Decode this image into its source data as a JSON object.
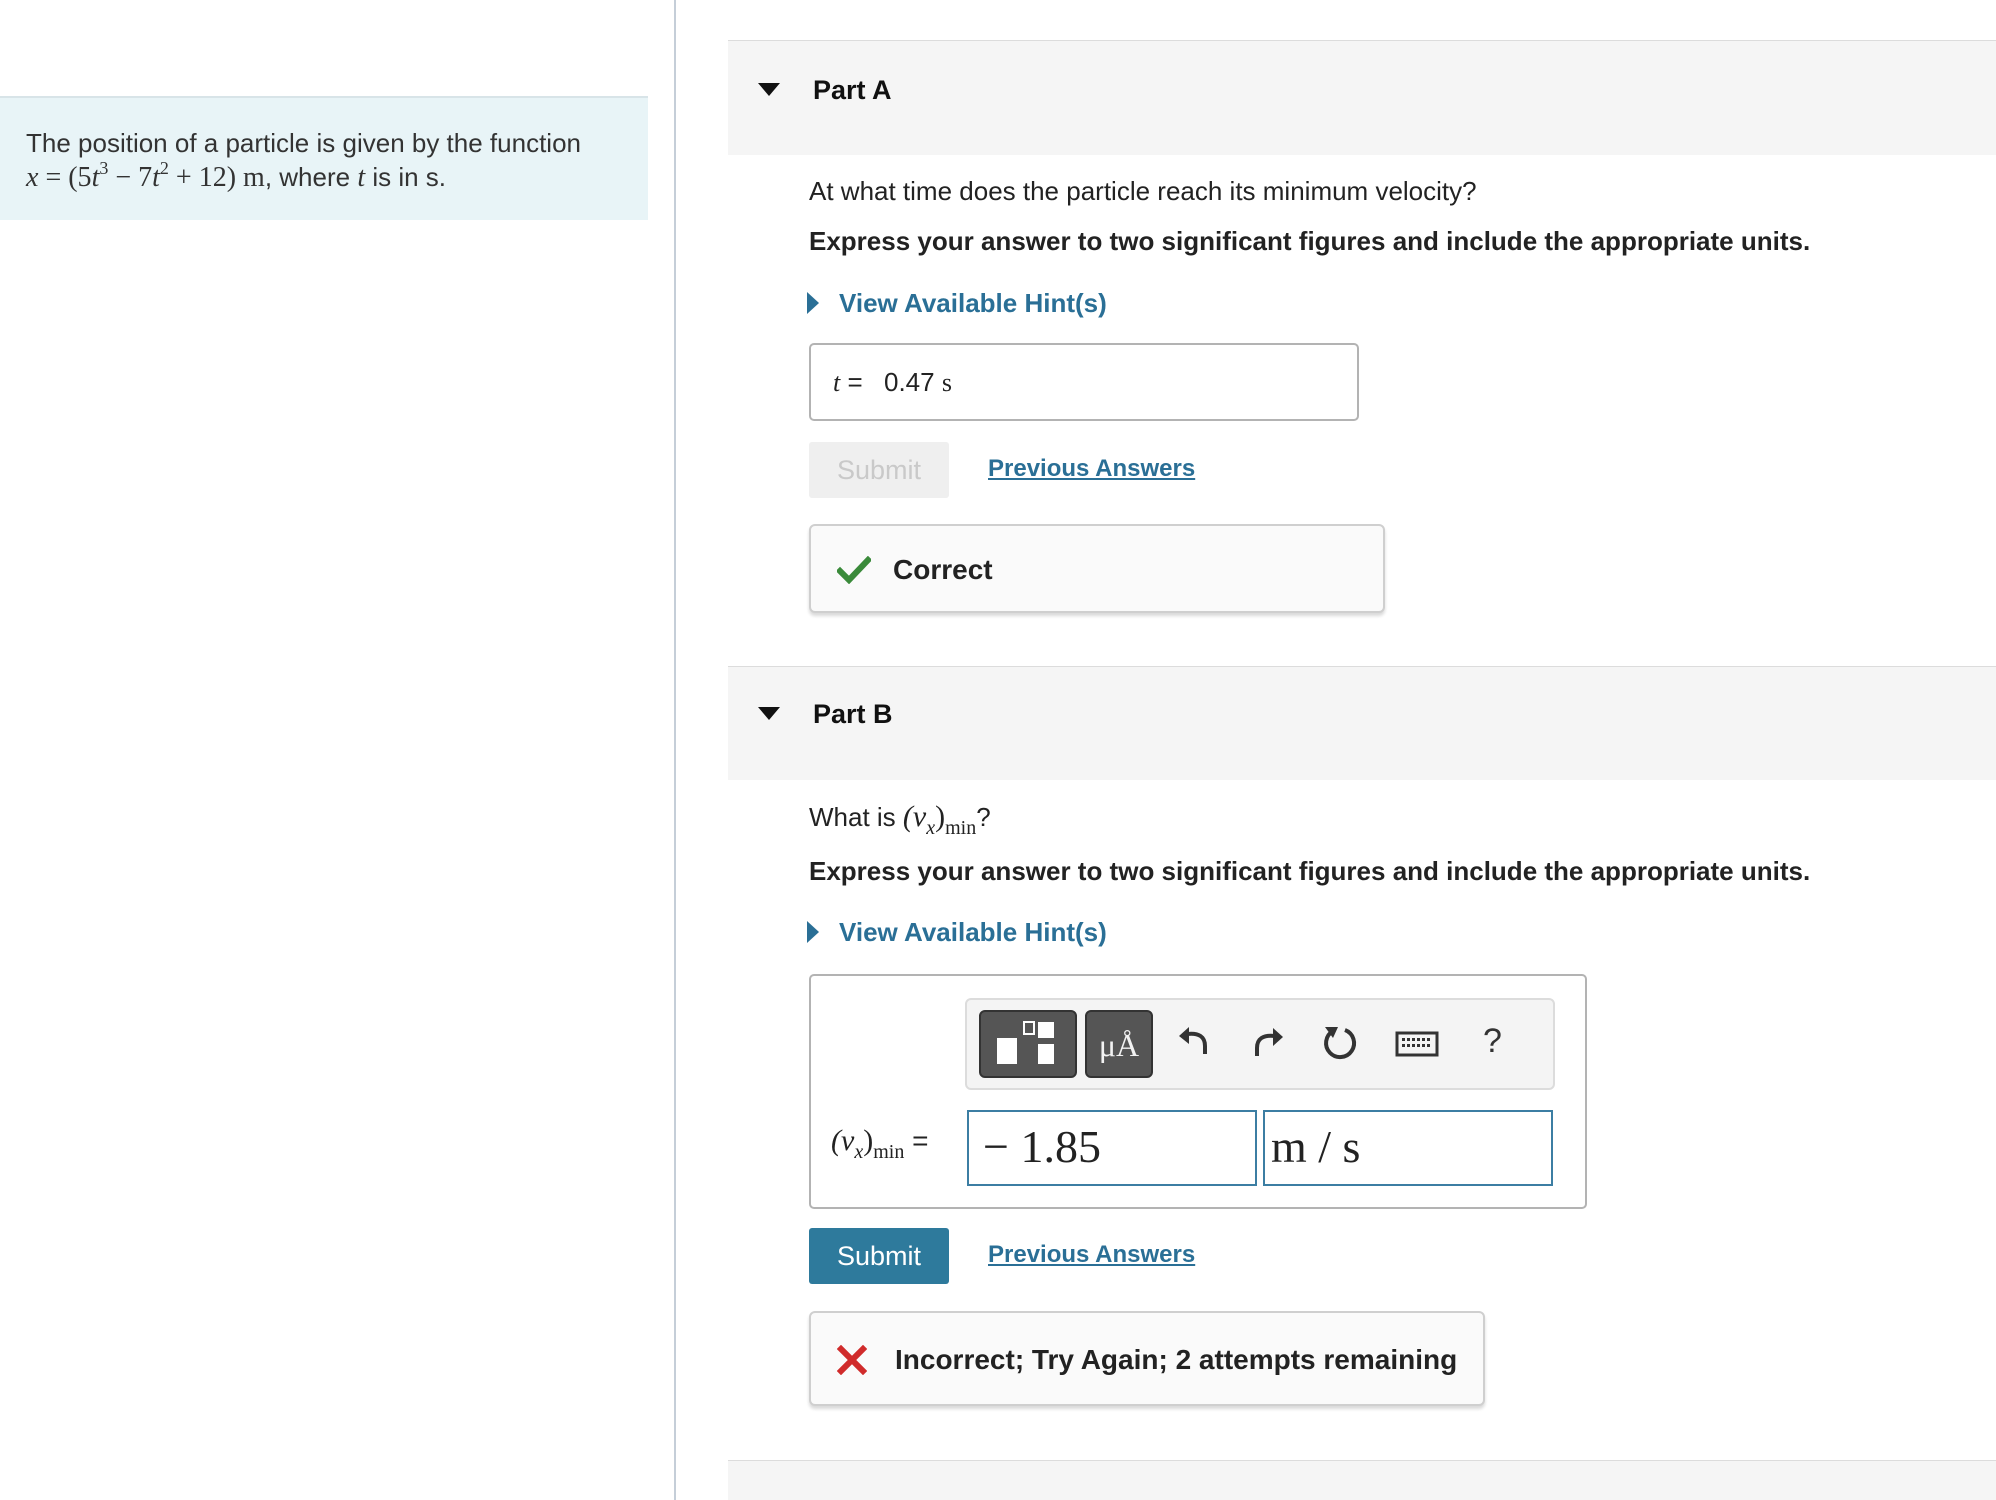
{
  "intro": {
    "line1": "The position of a particle is given by the function",
    "eq_x": "x",
    "eq_eq": " = (5",
    "eq_t1": "t",
    "eq_exp1": "3",
    "eq_mid": " − 7",
    "eq_t2": "t",
    "eq_exp2": "2",
    "eq_end": " + 12) m",
    "where": ", where ",
    "t": "t",
    "tail": " is in s."
  },
  "part_a": {
    "title": "Part A",
    "question": "At what time does the particle reach its minimum velocity?",
    "instruction": "Express your answer to two significant figures and include the appropriate units.",
    "hint_label": "View Available Hint(s)",
    "answer_label_var": "t",
    "answer_label_eq": " = ",
    "answer_value": "0.47",
    "answer_unit": "s",
    "submit_label": "Submit",
    "previous_answers_label": "Previous Answers",
    "feedback": "Correct",
    "feedback_color": "#3a8a3a"
  },
  "part_b": {
    "title": "Part B",
    "question_prefix": "What is ",
    "question_var": "(v",
    "question_var_sub": "x",
    "question_var_close": ")",
    "question_sub": "min",
    "question_suffix": "?",
    "instruction": "Express your answer to two significant figures and include the appropriate units.",
    "hint_label": "View Available Hint(s)",
    "toolbar": {
      "units_label": "μÅ",
      "help_label": "?",
      "icons": [
        "template-icon",
        "undo-icon",
        "redo-icon",
        "reset-icon",
        "keyboard-icon"
      ]
    },
    "answer_label_var": "(v",
    "answer_label_sub_x": "x",
    "answer_label_close": ")",
    "answer_label_sub": "min",
    "answer_label_eq": " =",
    "answer_value": "− 1.85",
    "answer_unit": "m / s",
    "submit_label": "Submit",
    "previous_answers_label": "Previous Answers",
    "feedback": "Incorrect; Try Again; 2 attempts remaining",
    "feedback_color": "#d02b2b",
    "accent_color": "#2e7a9c"
  }
}
